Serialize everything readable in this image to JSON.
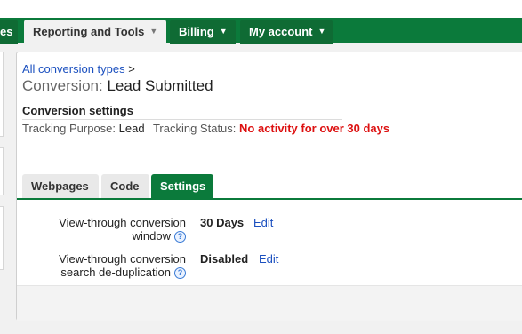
{
  "nav": {
    "tabs": [
      {
        "label": "es"
      },
      {
        "label": "Reporting and Tools"
      },
      {
        "label": "Billing"
      },
      {
        "label": "My account"
      }
    ]
  },
  "breadcrumb": {
    "link": "All conversion types",
    "sep": ">"
  },
  "title": {
    "prefix": "Conversion:",
    "name": "Lead Submitted"
  },
  "settings": {
    "heading": "Conversion settings",
    "purpose_label": "Tracking Purpose:",
    "purpose_value": "Lead",
    "status_label": "Tracking Status:",
    "status_value": "No activity for over 30 days",
    "status_color": "#dd1111"
  },
  "tabs": [
    "Webpages",
    "Code",
    "Settings"
  ],
  "rows": [
    {
      "label_line1": "View-through conversion",
      "label_line2": "window",
      "value": "30 Days",
      "edit": "Edit"
    },
    {
      "label_line1": "View-through conversion",
      "label_line2": "search de-duplication",
      "value": "Disabled",
      "edit": "Edit"
    }
  ],
  "colors": {
    "brand_green": "#0b7a3b",
    "link_blue": "#1a4fbf"
  }
}
